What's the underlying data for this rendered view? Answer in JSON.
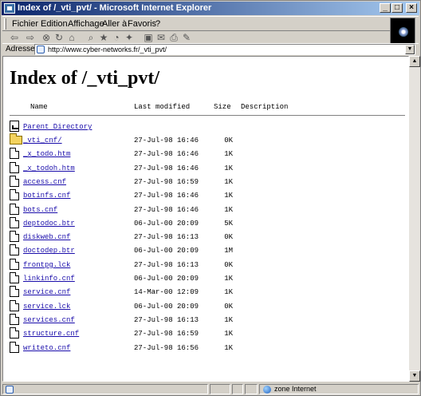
{
  "window": {
    "title": "Index of /_vti_pvt/ - Microsoft Internet Explorer"
  },
  "menu": [
    {
      "label": "Fichier"
    },
    {
      "label": "Edition"
    },
    {
      "label": "Affichage"
    },
    {
      "label": "Aller à"
    },
    {
      "label": "Favoris"
    },
    {
      "label": "?"
    }
  ],
  "address": {
    "label": "Adresse",
    "url": "http://www.cyber-networks.fr/_vti_pvt/"
  },
  "page": {
    "heading": "Index of /_vti_pvt/",
    "columns": {
      "name": "Name",
      "modified": "Last modified",
      "size": "Size",
      "description": "Description"
    },
    "parent": {
      "name": "Parent Directory"
    },
    "entries": [
      {
        "name": "_vti_cnf/",
        "date": "27-Jul-98 16:46",
        "size": "0K",
        "icon": "folder-icon"
      },
      {
        "name": "_x_todo.htm",
        "date": "27-Jul-98 16:46",
        "size": "1K",
        "icon": "file-icon"
      },
      {
        "name": "_x_todoh.htm",
        "date": "27-Jul-98 16:46",
        "size": "1K",
        "icon": "file-icon"
      },
      {
        "name": "access.cnf",
        "date": "27-Jul-98 16:59",
        "size": "1K",
        "icon": "file-icon"
      },
      {
        "name": "botinfs.cnf",
        "date": "27-Jul-98 16:46",
        "size": "1K",
        "icon": "file-icon"
      },
      {
        "name": "bots.cnf",
        "date": "27-Jul-98 16:46",
        "size": "1K",
        "icon": "file-icon"
      },
      {
        "name": "deptodoc.btr",
        "date": "06-Jul-00 20:09",
        "size": "5K",
        "icon": "file-icon"
      },
      {
        "name": "diskweb.cnf",
        "date": "27-Jul-98 16:13",
        "size": "0K",
        "icon": "file-icon"
      },
      {
        "name": "doctodep.btr",
        "date": "06-Jul-00 20:09",
        "size": "1M",
        "icon": "file-icon"
      },
      {
        "name": "frontpg.lck",
        "date": "27-Jul-98 16:13",
        "size": "0K",
        "icon": "file-icon"
      },
      {
        "name": "linkinfo.cnf",
        "date": "06-Jul-00 20:09",
        "size": "1K",
        "icon": "file-icon"
      },
      {
        "name": "service.cnf",
        "date": "14-Mar-00 12:09",
        "size": "1K",
        "icon": "file-icon"
      },
      {
        "name": "service.lck",
        "date": "06-Jul-00 20:09",
        "size": "0K",
        "icon": "file-icon"
      },
      {
        "name": "services.cnf",
        "date": "27-Jul-98 16:13",
        "size": "1K",
        "icon": "file-icon"
      },
      {
        "name": "structure.cnf",
        "date": "27-Jul-98 16:59",
        "size": "1K",
        "icon": "file-icon"
      },
      {
        "name": "writeto.cnf",
        "date": "27-Jul-98 16:56",
        "size": "1K",
        "icon": "file-icon"
      }
    ]
  },
  "status": {
    "zone": "zone Internet"
  },
  "colors": {
    "titlebar": "#0a246a",
    "link": "#1a0dab",
    "chrome": "#d4d0c8"
  }
}
